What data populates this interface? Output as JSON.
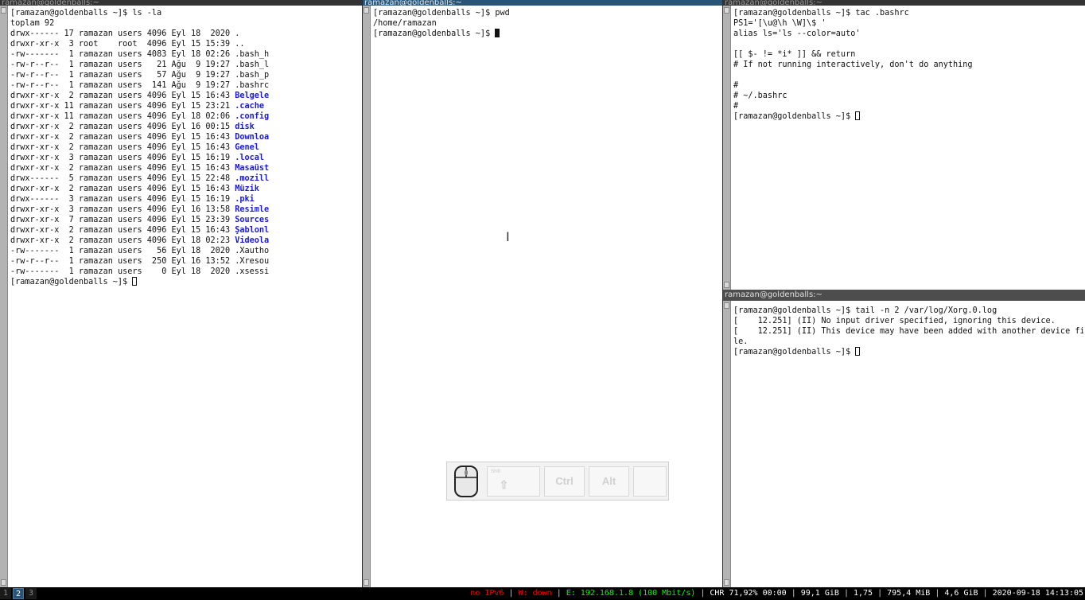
{
  "windows": {
    "left": {
      "title": "ramazan@goldenballs:~",
      "lines": [
        {
          "text": "[ramazan@goldenballs ~]$ ls -la"
        },
        {
          "text": "toplam 92"
        },
        {
          "perm": "drwx------",
          "n": "17",
          "owner": "ramazan",
          "group": "users",
          "size": "4096",
          "date": "Eyl 18  2020",
          "name": ".",
          "dir": false
        },
        {
          "perm": "drwxr-xr-x",
          "n": " 3",
          "owner": "root   ",
          "group": "root ",
          "size": "4096",
          "date": "Eyl 15 15:39",
          "name": "..",
          "dir": false
        },
        {
          "perm": "-rw-------",
          "n": " 1",
          "owner": "ramazan",
          "group": "users",
          "size": "4083",
          "date": "Eyl 18 02:26",
          "name": ".bash_h",
          "dir": false
        },
        {
          "perm": "-rw-r--r--",
          "n": " 1",
          "owner": "ramazan",
          "group": "users",
          "size": "  21",
          "date": "Ağu  9 19:27",
          "name": ".bash_l",
          "dir": false
        },
        {
          "perm": "-rw-r--r--",
          "n": " 1",
          "owner": "ramazan",
          "group": "users",
          "size": "  57",
          "date": "Ağu  9 19:27",
          "name": ".bash_p",
          "dir": false
        },
        {
          "perm": "-rw-r--r--",
          "n": " 1",
          "owner": "ramazan",
          "group": "users",
          "size": " 141",
          "date": "Ağu  9 19:27",
          "name": ".bashrc",
          "dir": false
        },
        {
          "perm": "drwxr-xr-x",
          "n": " 2",
          "owner": "ramazan",
          "group": "users",
          "size": "4096",
          "date": "Eyl 15 16:43",
          "name": "Belgele",
          "dir": true
        },
        {
          "perm": "drwxr-xr-x",
          "n": "11",
          "owner": "ramazan",
          "group": "users",
          "size": "4096",
          "date": "Eyl 15 23:21",
          "name": ".cache",
          "dir": true
        },
        {
          "perm": "drwxr-xr-x",
          "n": "11",
          "owner": "ramazan",
          "group": "users",
          "size": "4096",
          "date": "Eyl 18 02:06",
          "name": ".config",
          "dir": true
        },
        {
          "perm": "drwxr-xr-x",
          "n": " 2",
          "owner": "ramazan",
          "group": "users",
          "size": "4096",
          "date": "Eyl 16 00:15",
          "name": "disk",
          "dir": true
        },
        {
          "perm": "drwxr-xr-x",
          "n": " 2",
          "owner": "ramazan",
          "group": "users",
          "size": "4096",
          "date": "Eyl 15 16:43",
          "name": "Downloa",
          "dir": true
        },
        {
          "perm": "drwxr-xr-x",
          "n": " 2",
          "owner": "ramazan",
          "group": "users",
          "size": "4096",
          "date": "Eyl 15 16:43",
          "name": "Genel",
          "dir": true
        },
        {
          "perm": "drwxr-xr-x",
          "n": " 3",
          "owner": "ramazan",
          "group": "users",
          "size": "4096",
          "date": "Eyl 15 16:19",
          "name": ".local",
          "dir": true
        },
        {
          "perm": "drwxr-xr-x",
          "n": " 2",
          "owner": "ramazan",
          "group": "users",
          "size": "4096",
          "date": "Eyl 15 16:43",
          "name": "Masaüst",
          "dir": true
        },
        {
          "perm": "drwx------",
          "n": " 5",
          "owner": "ramazan",
          "group": "users",
          "size": "4096",
          "date": "Eyl 15 22:48",
          "name": ".mozill",
          "dir": true
        },
        {
          "perm": "drwxr-xr-x",
          "n": " 2",
          "owner": "ramazan",
          "group": "users",
          "size": "4096",
          "date": "Eyl 15 16:43",
          "name": "Müzik",
          "dir": true
        },
        {
          "perm": "drwx------",
          "n": " 3",
          "owner": "ramazan",
          "group": "users",
          "size": "4096",
          "date": "Eyl 15 16:19",
          "name": ".pki",
          "dir": true
        },
        {
          "perm": "drwxr-xr-x",
          "n": " 3",
          "owner": "ramazan",
          "group": "users",
          "size": "4096",
          "date": "Eyl 16 13:58",
          "name": "Resimle",
          "dir": true
        },
        {
          "perm": "drwxr-xr-x",
          "n": " 7",
          "owner": "ramazan",
          "group": "users",
          "size": "4096",
          "date": "Eyl 15 23:39",
          "name": "Sources",
          "dir": true
        },
        {
          "perm": "drwxr-xr-x",
          "n": " 2",
          "owner": "ramazan",
          "group": "users",
          "size": "4096",
          "date": "Eyl 15 16:43",
          "name": "Şablonl",
          "dir": true
        },
        {
          "perm": "drwxr-xr-x",
          "n": " 2",
          "owner": "ramazan",
          "group": "users",
          "size": "4096",
          "date": "Eyl 18 02:23",
          "name": "Videola",
          "dir": true
        },
        {
          "perm": "-rw-------",
          "n": " 1",
          "owner": "ramazan",
          "group": "users",
          "size": "  56",
          "date": "Eyl 18  2020",
          "name": ".Xautho",
          "dir": false
        },
        {
          "perm": "-rw-r--r--",
          "n": " 1",
          "owner": "ramazan",
          "group": "users",
          "size": " 250",
          "date": "Eyl 16 13:52",
          "name": ".Xresou",
          "dir": false
        },
        {
          "perm": "-rw-------",
          "n": " 1",
          "owner": "ramazan",
          "group": "users",
          "size": "   0",
          "date": "Eyl 18  2020",
          "name": ".xsessi",
          "dir": false
        }
      ],
      "prompt": "[ramazan@goldenballs ~]$ "
    },
    "middle": {
      "title": "ramazan@goldenballs:~",
      "lines": [
        "[ramazan@goldenballs ~]$ pwd",
        "/home/ramazan"
      ],
      "prompt": "[ramazan@goldenballs ~]$ "
    },
    "top_right": {
      "title": "ramazan@goldenballs:~",
      "lines": [
        "[ramazan@goldenballs ~]$ tac .bashrc",
        "PS1='[\\u@\\h \\W]\\$ '",
        "alias ls='ls --color=auto'",
        "",
        "[[ $- != *i* ]] && return",
        "# If not running interactively, don't do anything",
        "",
        "#",
        "# ~/.bashrc",
        "#"
      ],
      "prompt": "[ramazan@goldenballs ~]$ "
    },
    "bottom_right": {
      "title": "ramazan@goldenballs:~",
      "lines": [
        "[ramazan@goldenballs ~]$ tail -n 2 /var/log/Xorg.0.log",
        "[    12.251] (II) No input driver specified, ignoring this device.",
        "[    12.251] (II) This device may have been added with another device fi",
        "le."
      ],
      "prompt": "[ramazan@goldenballs ~]$ "
    }
  },
  "key_monitor": {
    "shift_small": "Shift",
    "shift_symbol": "⇧",
    "ctrl": "Ctrl",
    "alt": "Alt"
  },
  "statusbar": {
    "workspaces": [
      "1",
      "2",
      "3"
    ],
    "focused_workspace": "2",
    "ipv6": "no IPv6",
    "wireless": "W: down",
    "ethernet": "E: 192.168.1.8 (100 Mbit/s)",
    "cpu": "CHR 71,92% 00:00",
    "disk": "99,1 GiB",
    "load": "1,75",
    "memory": "795,4 MiB",
    "disk2": "4,6 GiB",
    "datetime": "2020-09-18 14:13:05"
  },
  "colors": {
    "focused_title": "#285577",
    "directory_text": "#1a1ad6",
    "status_red": "#ff0000",
    "status_green": "#00ff00"
  }
}
